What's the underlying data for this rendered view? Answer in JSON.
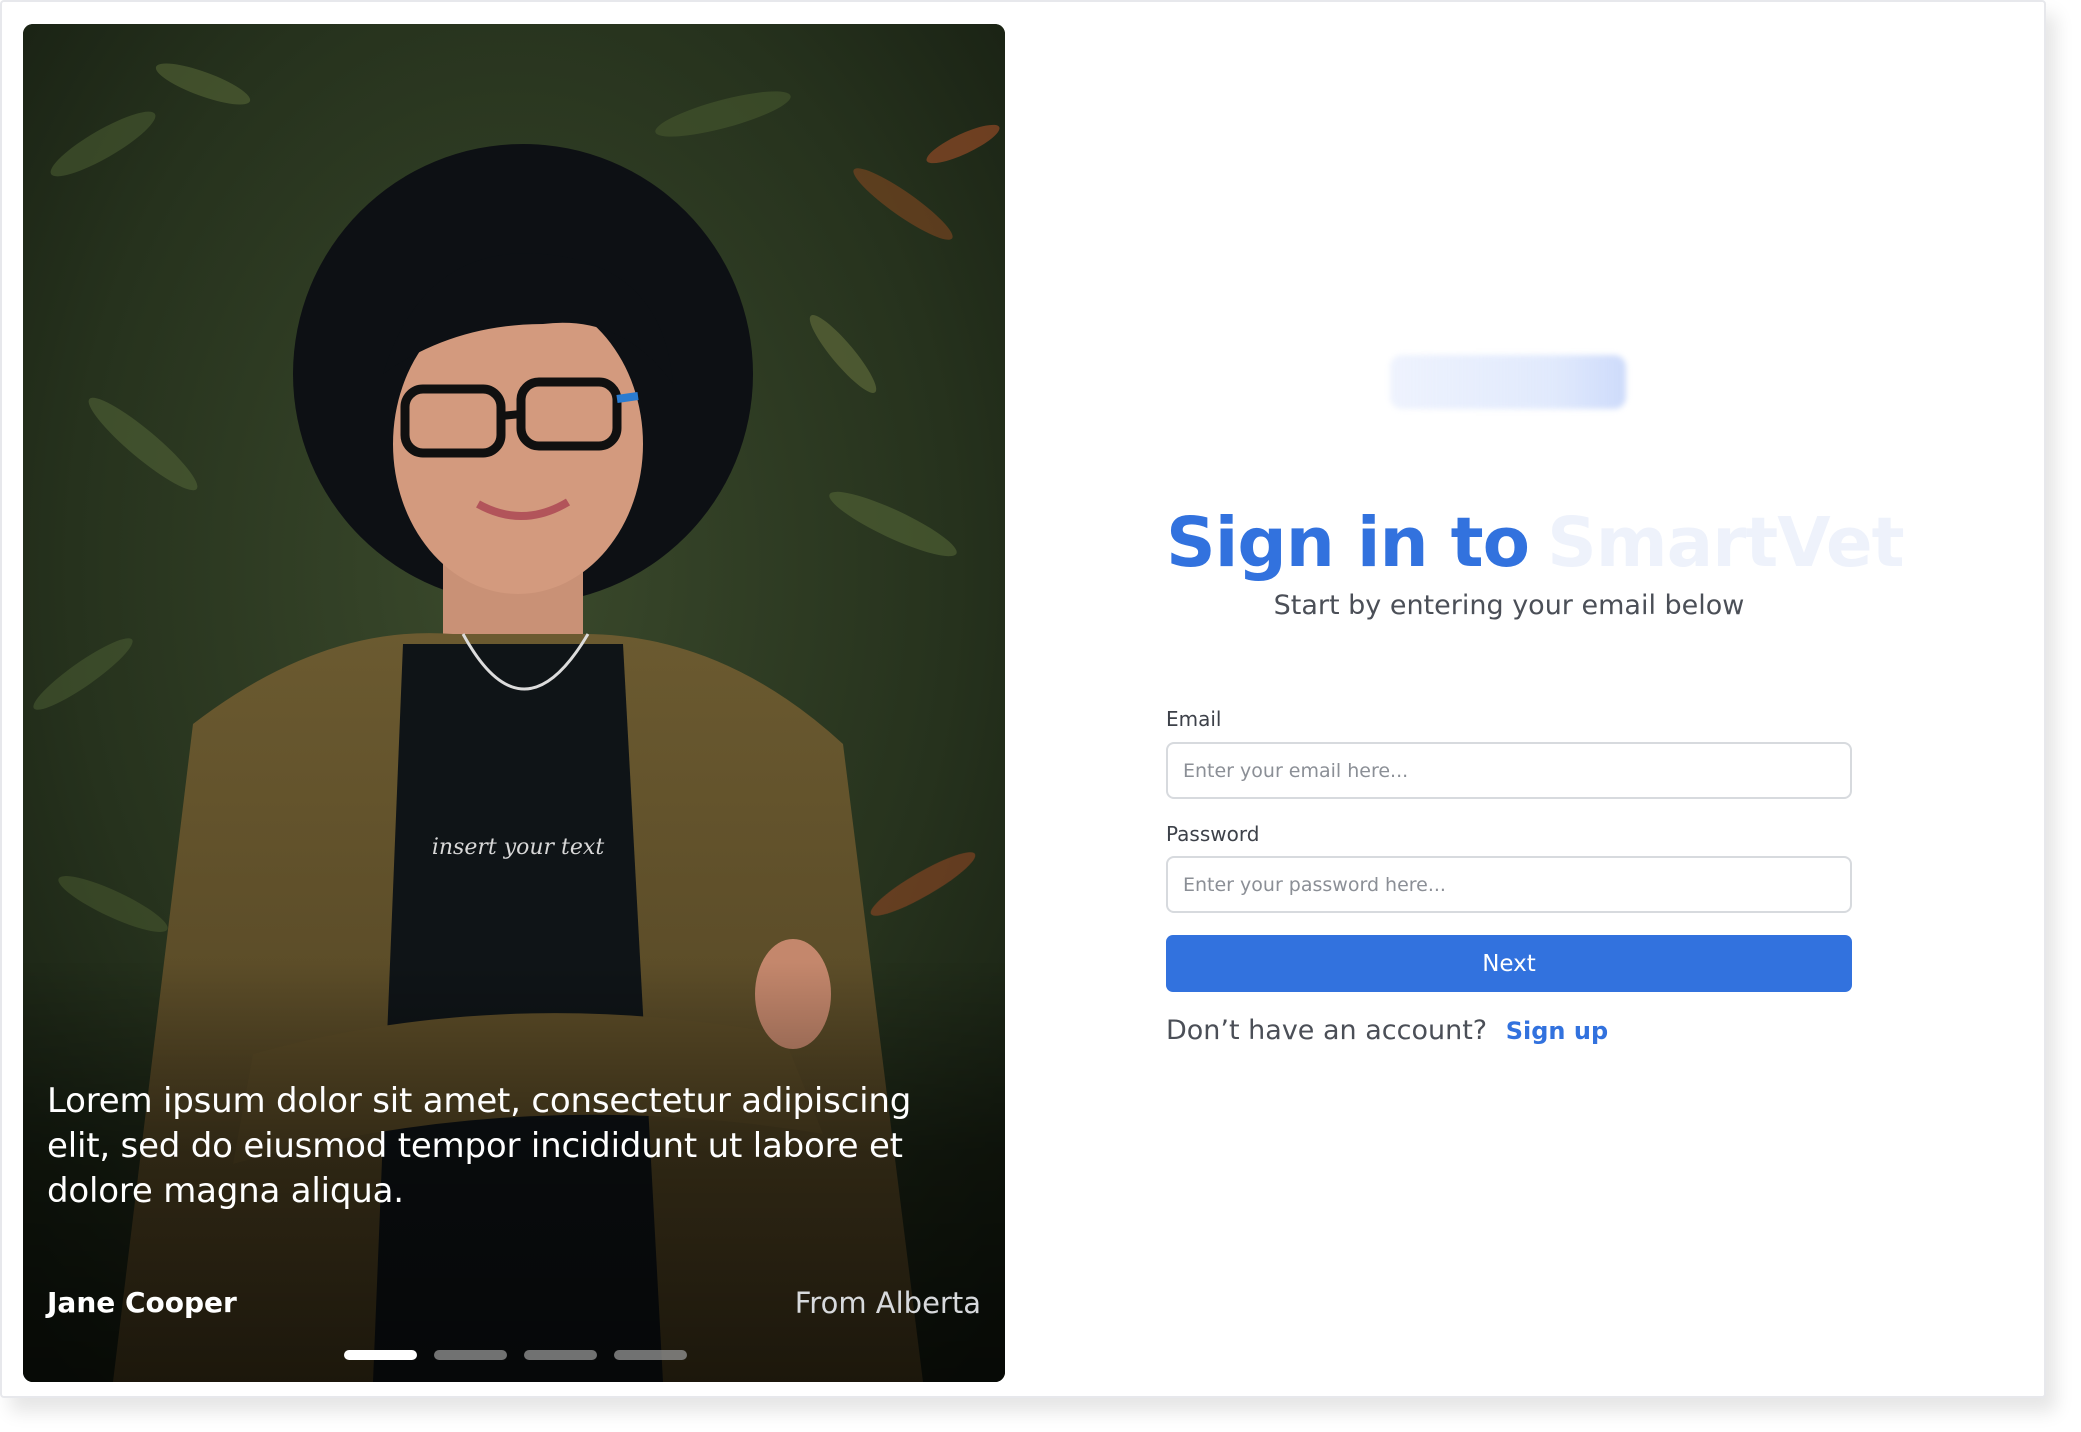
{
  "hero": {
    "quote": "Lorem ipsum dolor sit amet, consectetur adipiscing elit, sed do eiusmod tempor incididunt ut labore et dolore magna aliqua.",
    "author": "Jane Cooper",
    "location": "From Alberta",
    "slides": {
      "count": 4,
      "active_index": 0
    },
    "shirt_text": "insert your text"
  },
  "form": {
    "title": "Sign in to",
    "subtitle": "Start by entering your email below",
    "email_label": "Email",
    "email_placeholder": "Enter your email here...",
    "email_value": "",
    "password_label": "Password",
    "password_placeholder": "Enter your password here...",
    "password_value": "",
    "next_label": "Next",
    "signup_prompt": "Don’t have an account?",
    "signup_link": "Sign up"
  },
  "colors": {
    "accent": "#3272DE",
    "text_muted": "#4B4F57",
    "input_border": "#D7DADE"
  }
}
